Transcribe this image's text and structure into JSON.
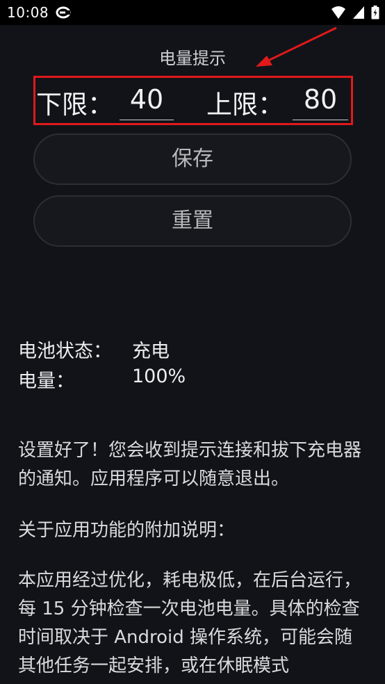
{
  "status_bar": {
    "time": "10:08"
  },
  "battery_alert": {
    "title": "电量提示",
    "lower_label": "下限：",
    "lower_value": "40",
    "upper_label": "上限：",
    "upper_value": "80"
  },
  "buttons": {
    "save": "保存",
    "reset": "重置"
  },
  "battery_info": {
    "status_label": "电池状态：",
    "status_value": "充电",
    "level_label": "电量：",
    "level_value": "100%"
  },
  "messages": {
    "setup_done": "设置好了！您会收到提示连接和拔下充电器的通知。应用程序可以随意退出。",
    "extra_heading": "关于应用功能的附加说明：",
    "extra_body": "本应用经过优化，耗电极低，在后台运行，每 15 分钟检查一次电池电量。具体的检查时间取决于 Android 操作系统，可能会随其他任务一起安排，或在休眠模式"
  },
  "colors": {
    "background": "#121318",
    "highlight_box": "#e0191b",
    "button_border": "#2c2e33"
  },
  "icons": [
    "sync-icon",
    "wifi-icon",
    "signal-icon",
    "battery-icon"
  ]
}
